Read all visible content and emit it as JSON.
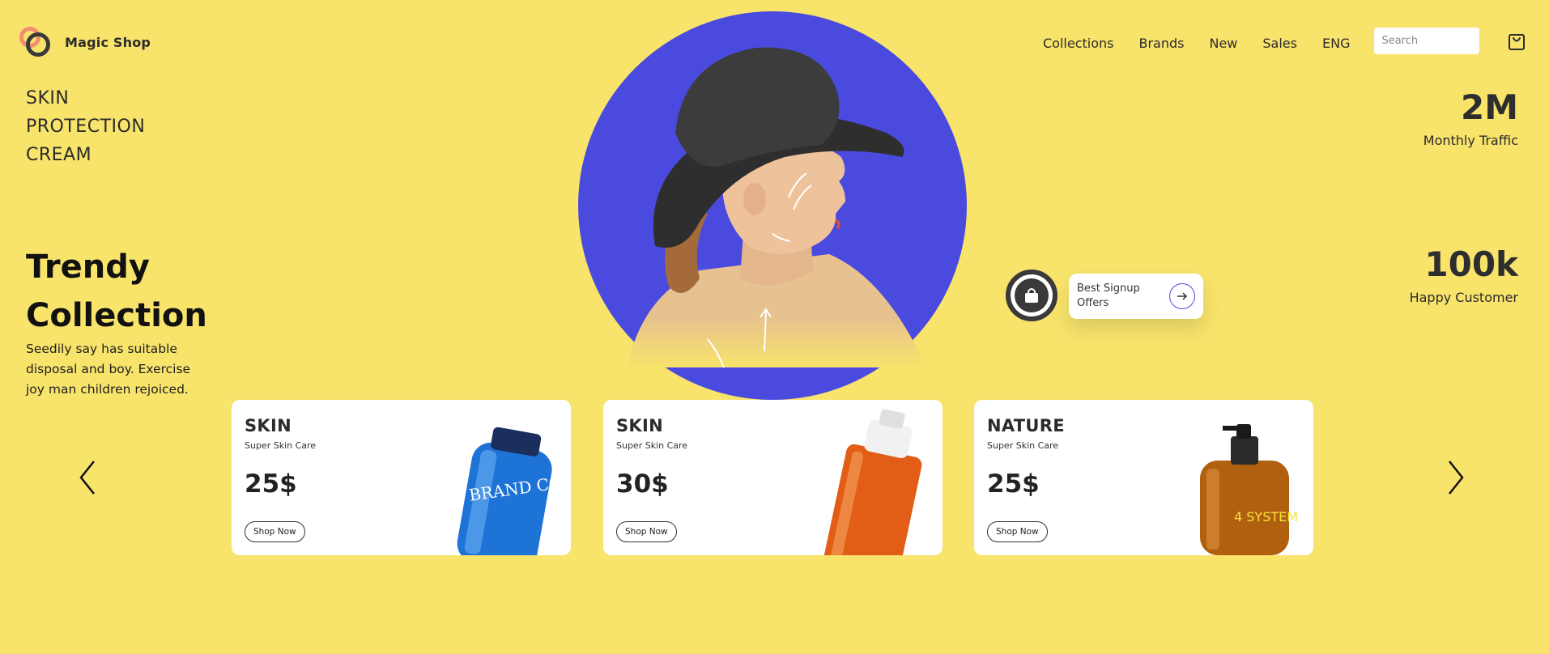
{
  "brand": {
    "name": "Magic Shop"
  },
  "nav": {
    "links": [
      "Collections",
      "Brands",
      "New",
      "Sales",
      "ENG"
    ],
    "search_placeholder": "Search",
    "cart_icon": "shopping-bag-icon"
  },
  "headline": {
    "lines": [
      "SKIN",
      "PROTECTION",
      "CREAM"
    ]
  },
  "trendy": {
    "title_lines": [
      "Trendy",
      "Collection"
    ],
    "description": "Seedily say has suitable disposal and boy. Exercise joy man children rejoiced."
  },
  "stats": [
    {
      "value": "2M",
      "label": "Monthly Traffic"
    },
    {
      "value": "100k",
      "label": "Happy Customer"
    }
  ],
  "signup": {
    "text": "Best Signup Offers",
    "icon": "arrow-right-icon"
  },
  "colors": {
    "background": "#f8e36b",
    "accent": "#4a4adf",
    "dark": "#3a3a3a",
    "logo_orange": "#f08f72"
  },
  "products": [
    {
      "name": "SKIN",
      "subtitle": "Super Skin Care",
      "price": "25$",
      "button": "Shop Now",
      "image": "blue-bottle",
      "bottle_text": "BRAND COSMETICS"
    },
    {
      "name": "SKIN",
      "subtitle": "Super Skin Care",
      "price": "30$",
      "button": "Shop Now",
      "image": "orange-bottle"
    },
    {
      "name": "NATURE",
      "subtitle": "Super Skin Care",
      "price": "25$",
      "button": "Shop Now",
      "image": "amber-spray-bottle",
      "bottle_text": "4 SYSTEM"
    }
  ]
}
